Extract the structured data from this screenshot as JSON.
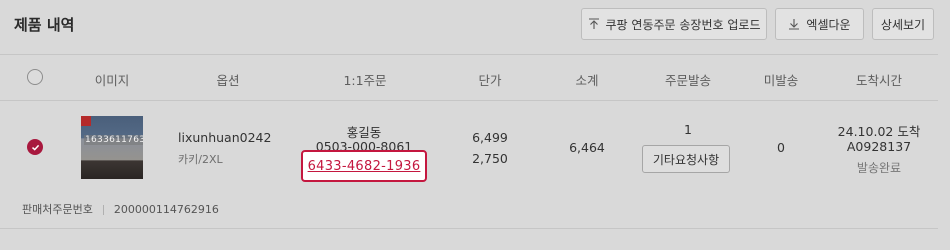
{
  "header": {
    "title": "제품 내역",
    "buttons": {
      "coupang_upload": "쿠팡 연동주문 송장번호 업로드",
      "excel_download": "엑셀다운",
      "detail_view": "상세보기"
    }
  },
  "table": {
    "columns": [
      "이미지",
      "옵션",
      "1:1주문",
      "단가",
      "소계",
      "주문발송",
      "미발송",
      "도착시간"
    ],
    "row": {
      "selected": true,
      "image_watermark": "1633611763",
      "option_name": "lixunhuan0242",
      "option_detail": "카키/2XL",
      "order_name": "홍길동",
      "order_phone": "0503-000-8061",
      "order_tracking_link": "6433-4682-1936",
      "unit_price": "6,499",
      "unit_price_2": "2,750",
      "subtotal": "6,464",
      "shipped_count": "1",
      "request_button": "기타요청사항",
      "unshipped": "0",
      "arrival_line1": "24.10.02 도착",
      "arrival_line2": "A0928137",
      "arrival_status": "발송완료"
    }
  },
  "footer": {
    "label": "판매처주문번호",
    "value": "200000114762916"
  },
  "colors": {
    "accent": "#c4173f",
    "background": "#d9d9d9"
  }
}
